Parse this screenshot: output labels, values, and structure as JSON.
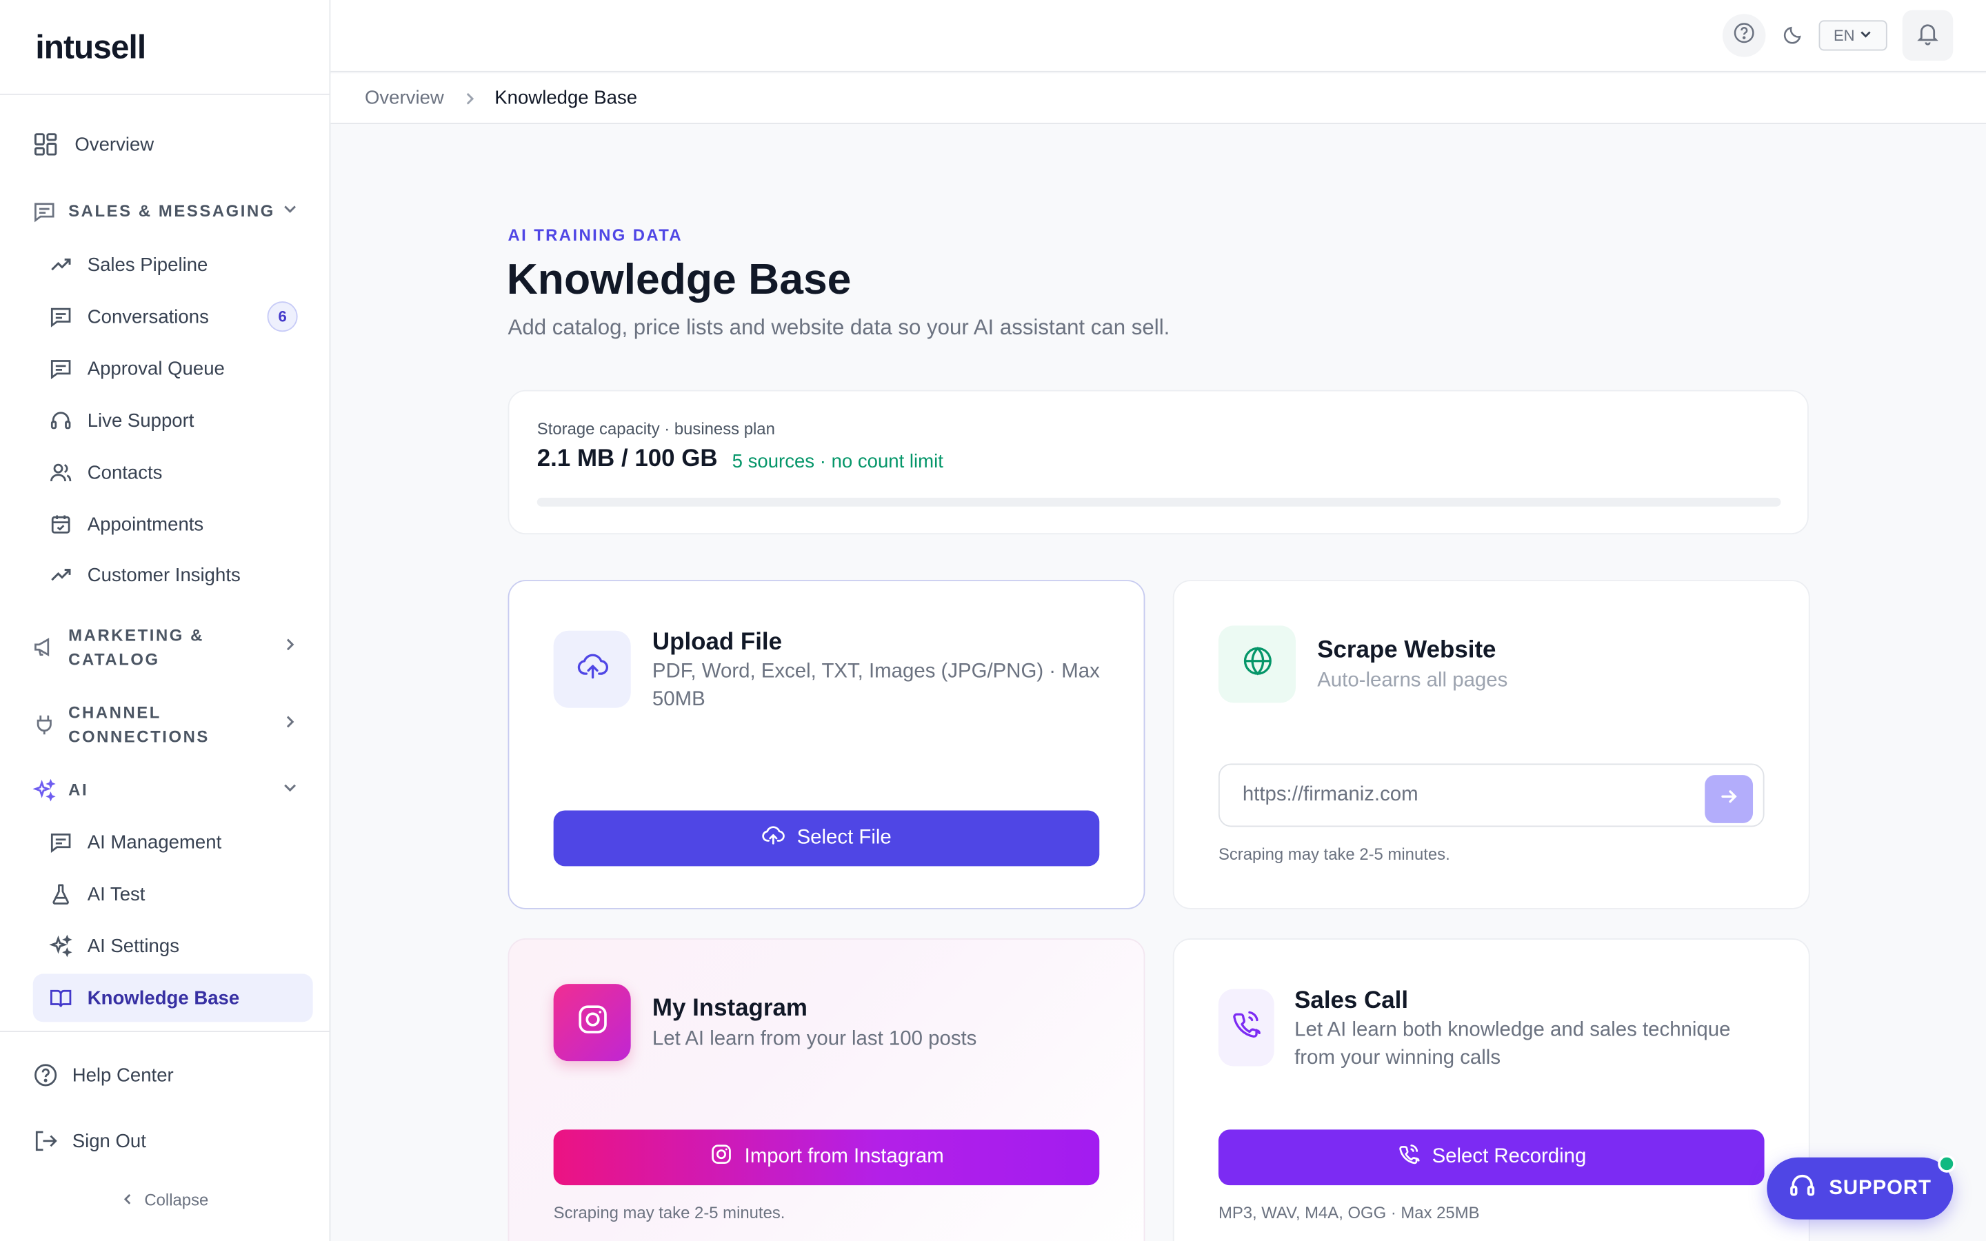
{
  "brand": {
    "logo": "intusell"
  },
  "sidebar": {
    "overview": "Overview",
    "sections": {
      "sales": "SALES & MESSAGING",
      "marketing": "MARKETING & CATALOG",
      "channels": "CHANNEL CONNECTIONS",
      "ai": "AI"
    },
    "sales_items": [
      {
        "label": "Sales Pipeline",
        "icon": "trend-up-icon"
      },
      {
        "label": "Conversations",
        "icon": "message-icon",
        "badge": "6"
      },
      {
        "label": "Approval Queue",
        "icon": "message-icon"
      },
      {
        "label": "Live Support",
        "icon": "headset-icon"
      },
      {
        "label": "Contacts",
        "icon": "users-icon"
      },
      {
        "label": "Appointments",
        "icon": "calendar-icon"
      },
      {
        "label": "Customer Insights",
        "icon": "trend-up-icon"
      }
    ],
    "ai_items": [
      {
        "label": "AI Management",
        "icon": "message-icon"
      },
      {
        "label": "AI Test",
        "icon": "flask-icon"
      },
      {
        "label": "AI Settings",
        "icon": "sparkles-icon"
      },
      {
        "label": "Knowledge Base",
        "icon": "book-icon",
        "active": true
      }
    ],
    "help": "Help Center",
    "signout": "Sign Out",
    "collapse": "Collapse"
  },
  "topbar": {
    "language": "EN"
  },
  "breadcrumb": {
    "parent": "Overview",
    "current": "Knowledge Base"
  },
  "page": {
    "eyebrow": "AI TRAINING DATA",
    "title": "Knowledge Base",
    "subtitle": "Add catalog, price lists and website data so your AI assistant can sell."
  },
  "storage": {
    "label": "Storage capacity · business plan",
    "used": "2.1 MB / 100 GB",
    "note": "5 sources · no count limit",
    "fill_fraction": 2e-05
  },
  "upload": {
    "title": "Upload File",
    "desc": "PDF, Word, Excel, TXT, Images (JPG/PNG) · Max 50MB",
    "button": "Select File"
  },
  "scrape": {
    "title": "Scrape Website",
    "desc": "Auto-learns all pages",
    "placeholder": "https://firmaniz.com",
    "hint": "Scraping may take 2-5 minutes."
  },
  "instagram": {
    "title": "My Instagram",
    "desc": "Let AI learn from your last 100 posts",
    "button": "Import from Instagram",
    "hint": "Scraping may take 2-5 minutes."
  },
  "call": {
    "title": "Sales Call",
    "desc": "Let AI learn both knowledge and sales technique from your winning calls",
    "button": "Select Recording",
    "hint": "MP3, WAV, M4A, OGG · Max 25MB"
  },
  "support": {
    "label": "SUPPORT"
  },
  "colors": {
    "accent": "#4f46e5",
    "success": "#059669",
    "instagram_from": "#ec1382",
    "instagram_to": "#a21cf0",
    "call": "#7c2bf3"
  }
}
